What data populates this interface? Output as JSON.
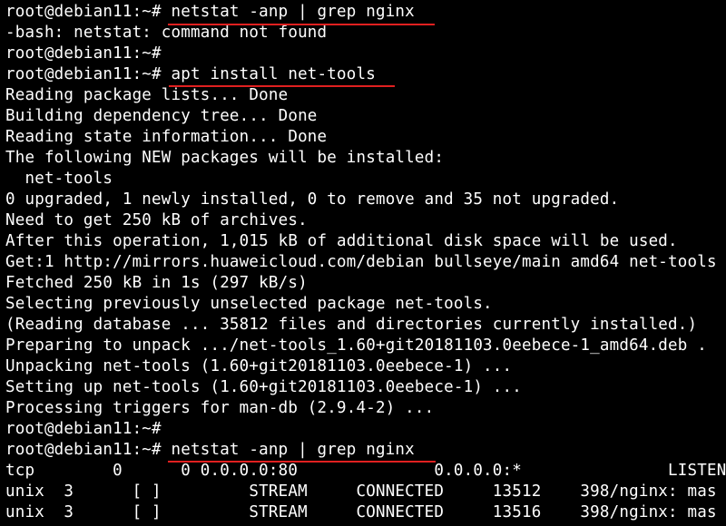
{
  "terminal": {
    "prompt": "root@debian11:~# ",
    "highlight_color": "#e02020",
    "lines": [
      "root@debian11:~# netstat -anp | grep nginx",
      "-bash: netstat: command not found",
      "root@debian11:~#",
      "root@debian11:~# apt install net-tools",
      "Reading package lists... Done",
      "Building dependency tree... Done",
      "Reading state information... Done",
      "The following NEW packages will be installed:",
      "  net-tools",
      "0 upgraded, 1 newly installed, 0 to remove and 35 not upgraded.",
      "Need to get 250 kB of archives.",
      "After this operation, 1,015 kB of additional disk space will be used.",
      "Get:1 http://mirrors.huaweicloud.com/debian bullseye/main amd64 net-tools",
      "Fetched 250 kB in 1s (297 kB/s)",
      "Selecting previously unselected package net-tools.",
      "(Reading database ... 35812 files and directories currently installed.)",
      "Preparing to unpack .../net-tools_1.60+git20181103.0eebece-1_amd64.deb .",
      "Unpacking net-tools (1.60+git20181103.0eebece-1) ...",
      "Setting up net-tools (1.60+git20181103.0eebece-1) ...",
      "Processing triggers for man-db (2.9.4-2) ...",
      "root@debian11:~#",
      "root@debian11:~# netstat -anp | grep nginx",
      "tcp        0      0 0.0.0.0:80              0.0.0.0:*               LISTEN",
      "unix  3      [ ]         STREAM     CONNECTED     13512    398/nginx: mas",
      "unix  3      [ ]         STREAM     CONNECTED     13516    398/nginx: mas"
    ]
  }
}
